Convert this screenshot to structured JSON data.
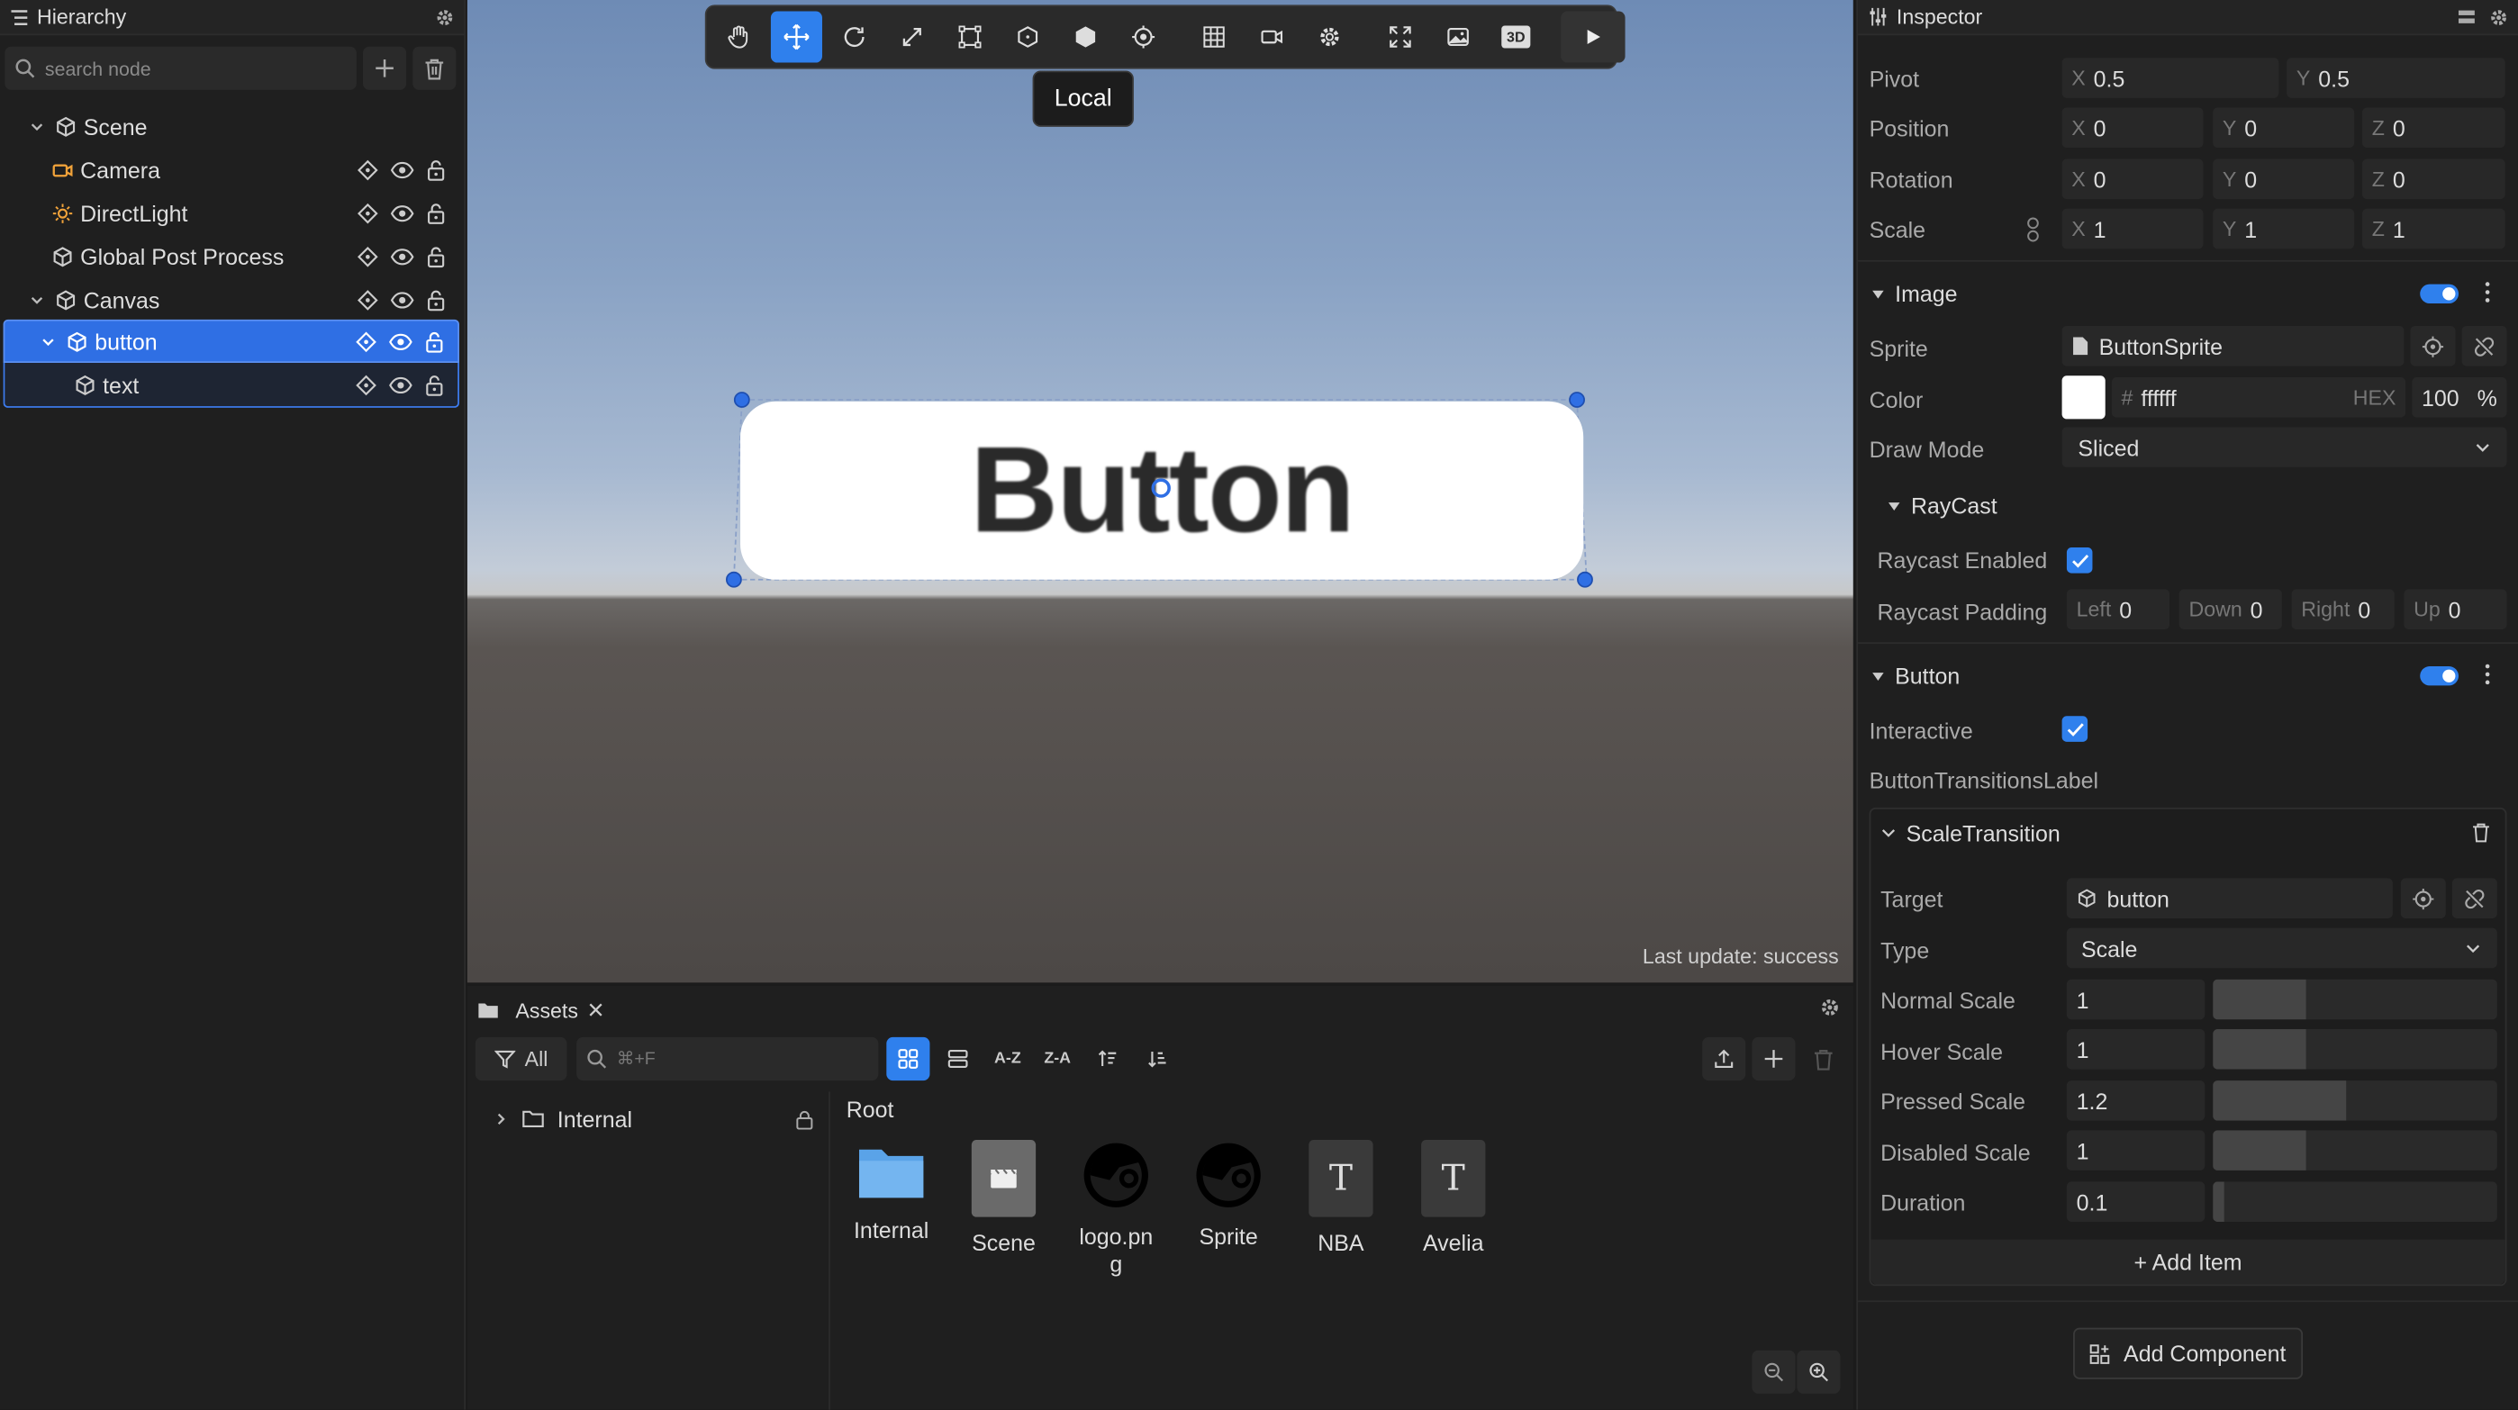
{
  "hierarchy": {
    "title": "Hierarchy",
    "search_placeholder": "search node",
    "nodes": [
      {
        "label": "Scene"
      },
      {
        "label": "Camera"
      },
      {
        "label": "DirectLight"
      },
      {
        "label": "Global Post Process"
      },
      {
        "label": "Canvas"
      },
      {
        "label": "button"
      },
      {
        "label": "text"
      }
    ]
  },
  "viewport": {
    "tooltip": "Local",
    "button_text": "Button",
    "status": "Last update: success",
    "tools": [
      "hand-tool",
      "move-tool",
      "rotate-tool",
      "scale-tool",
      "rect-tool",
      "transform-tool",
      "object-tool",
      "pivot-tool",
      "grid-toggle",
      "camera-view",
      "settings",
      "maximize",
      "image-view",
      "3d-toggle",
      "play"
    ],
    "active_tool": "move-tool",
    "mode_3d_label": "3D"
  },
  "assets": {
    "tab": "Assets",
    "filter_label": "All",
    "search_placeholder": "⌘+F",
    "sort_az": "A-Z",
    "sort_za": "Z-A",
    "tree": [
      {
        "label": "Internal"
      }
    ],
    "root_label": "Root",
    "items": [
      {
        "name": "Internal",
        "icon": "folder-icon"
      },
      {
        "name": "Scene",
        "icon": "scene-file-icon"
      },
      {
        "name": "logo.png",
        "icon": "logo-icon"
      },
      {
        "name": "Sprite",
        "icon": "sprite-icon"
      },
      {
        "name": "NBA",
        "icon": "font-icon"
      },
      {
        "name": "Avelia",
        "icon": "font-icon"
      }
    ]
  },
  "inspector": {
    "title": "Inspector",
    "transform": {
      "pivot_label": "Pivot",
      "pivot": {
        "x": "0.5",
        "y": "0.5"
      },
      "position_label": "Position",
      "position": {
        "x": "0",
        "y": "0",
        "z": "0"
      },
      "rotation_label": "Rotation",
      "rotation": {
        "x": "0",
        "y": "0",
        "z": "0"
      },
      "scale_label": "Scale",
      "scale": {
        "x": "1",
        "y": "1",
        "z": "1"
      }
    },
    "image": {
      "title": "Image",
      "sprite_label": "Sprite",
      "sprite": "ButtonSprite",
      "color_label": "Color",
      "color_hex": "ffffff",
      "color_swatch": "#ffffff",
      "hex_label": "HEX",
      "alpha": "100",
      "alpha_unit": "%",
      "draw_mode_label": "Draw Mode",
      "draw_mode": "Sliced",
      "raycast_title": "RayCast",
      "raycast_enabled_label": "Raycast Enabled",
      "raycast_padding_label": "Raycast Padding",
      "padding": {
        "left_label": "Left",
        "left": "0",
        "down_label": "Down",
        "down": "0",
        "right_label": "Right",
        "right": "0",
        "up_label": "Up",
        "up": "0"
      }
    },
    "button": {
      "title": "Button",
      "interactive_label": "Interactive",
      "transition_label": "ButtonTransitionsLabel",
      "scale_transition": {
        "title": "ScaleTransition",
        "target_label": "Target",
        "target": "button",
        "type_label": "Type",
        "type": "Scale",
        "rows": [
          {
            "label": "Normal Scale",
            "value": "1",
            "level": 0.33
          },
          {
            "label": "Hover Scale",
            "value": "1",
            "level": 0.33
          },
          {
            "label": "Pressed Scale",
            "value": "1.2",
            "level": 0.47
          },
          {
            "label": "Disabled Scale",
            "value": "1",
            "level": 0.33
          },
          {
            "label": "Duration",
            "value": "0.1",
            "level": 0.04
          }
        ],
        "add_item": "+ Add Item"
      }
    },
    "add_component": "Add Component"
  },
  "colors": {
    "accent": "#2f80ed",
    "panel": "#1f1f1f"
  }
}
